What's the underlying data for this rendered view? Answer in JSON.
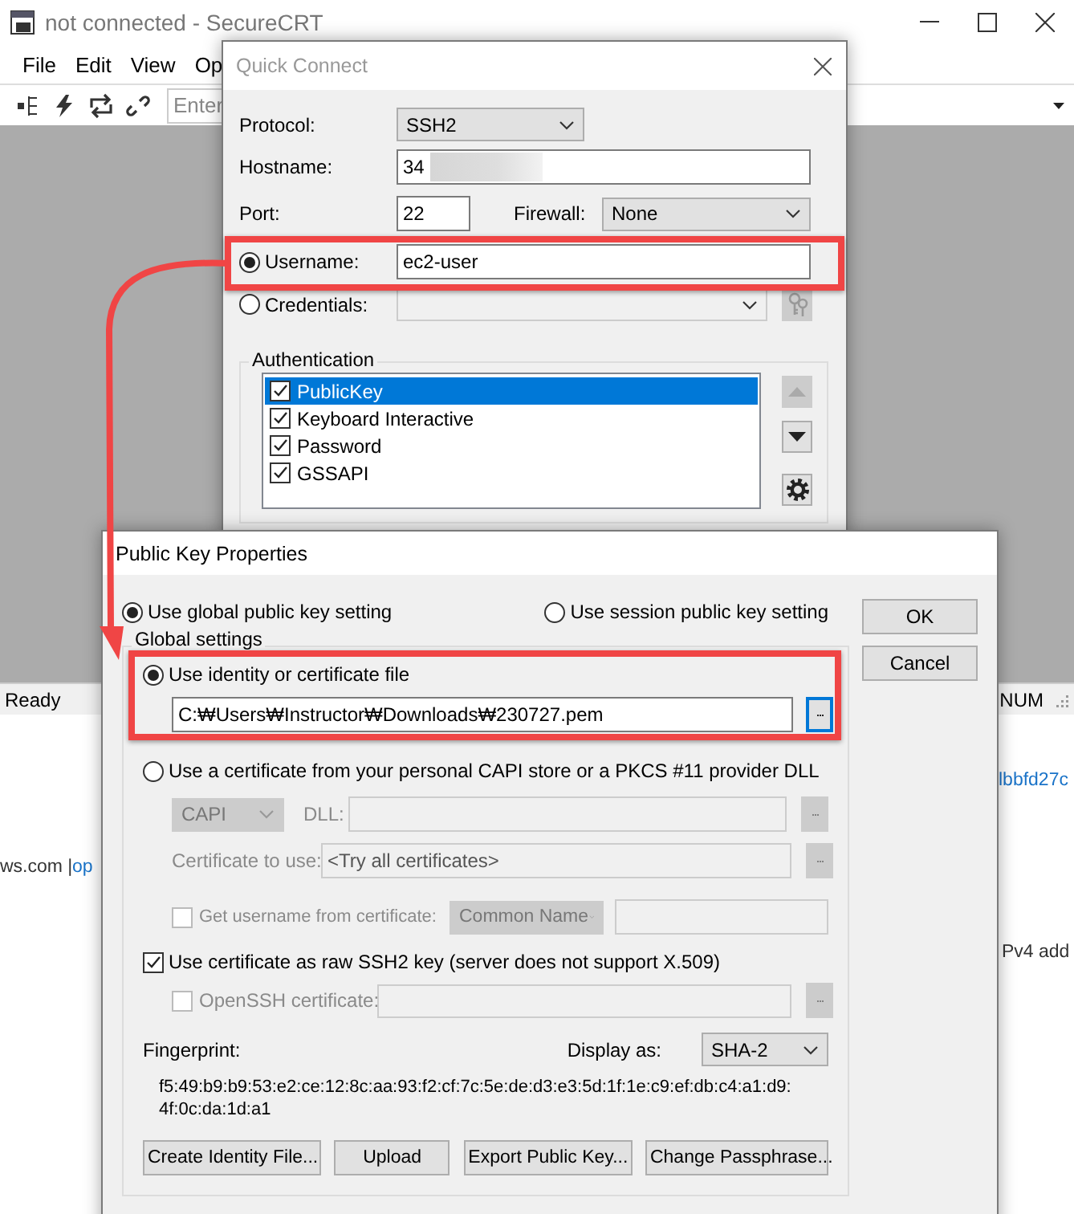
{
  "main_window": {
    "title": "not connected - SecureCRT",
    "menu": [
      "File",
      "Edit",
      "View",
      "Op"
    ],
    "toolbar_field": {
      "placeholder": "Enter"
    },
    "status_bar": {
      "left": "Ready",
      "indicator": "NUM"
    }
  },
  "background_page": {
    "fragments": [
      {
        "text": "lbbfd27c",
        "kind": "link"
      },
      {
        "text": "ws.com |",
        "kind": "plain"
      },
      {
        "text": "op",
        "kind": "link"
      },
      {
        "text": "Pv4 add",
        "kind": "plain"
      }
    ]
  },
  "quick_connect": {
    "title": "Quick Connect",
    "protocol": {
      "label": "Protocol:",
      "value": "SSH2"
    },
    "hostname": {
      "label": "Hostname:",
      "value": "34",
      "redacted": true
    },
    "port": {
      "label": "Port:",
      "value": "22"
    },
    "firewall": {
      "label": "Firewall:",
      "value": "None"
    },
    "username": {
      "label": "Username:",
      "value": "ec2-user",
      "selected": true
    },
    "credentials": {
      "label": "Credentials:",
      "selected": false,
      "disabled": true
    },
    "authentication": {
      "title": "Authentication",
      "items": [
        {
          "label": "PublicKey",
          "checked": true,
          "selected": true
        },
        {
          "label": "Keyboard Interactive",
          "checked": true,
          "selected": false
        },
        {
          "label": "Password",
          "checked": true,
          "selected": false
        },
        {
          "label": "GSSAPI",
          "checked": true,
          "selected": false
        }
      ],
      "order_buttons": [
        {
          "kind": "up",
          "disabled": true
        },
        {
          "kind": "down",
          "disabled": false
        }
      ]
    }
  },
  "public_key": {
    "title": "Public Key Properties",
    "scope": [
      {
        "label": "Use global public key setting",
        "selected": true
      },
      {
        "label": "Use session public key setting",
        "selected": false
      }
    ],
    "buttons": [
      "OK",
      "Cancel"
    ],
    "global_settings": {
      "title": "Global settings",
      "identity": {
        "label": "Use identity or certificate file",
        "selected": true,
        "path": "C:₩Users₩Instructor₩Downloads₩230727.pem"
      },
      "capi": {
        "label": "Use a certificate from your personal CAPI store or a PKCS #11 provider DLL",
        "selected": false,
        "type": "CAPI",
        "dll_label": "DLL:",
        "cert_label": "Certificate to use:",
        "cert_value": "<Try all certificates>",
        "disabled": true
      },
      "username_from_cert": {
        "label": "Get username from certificate:",
        "checked": false,
        "value": "Common Name",
        "disabled": true
      },
      "raw_ssh2": {
        "label": "Use certificate as raw SSH2 key (server does not support X.509)",
        "checked": true
      },
      "openssh": {
        "label": "OpenSSH certificate:",
        "checked": false,
        "disabled": true
      },
      "fingerprint": {
        "label": "Fingerprint:",
        "display_label": "Display as:",
        "display_value": "SHA-2",
        "lines": [
          "f5:49:b9:b9:53:e2:ce:12:8c:aa:93:f2:cf:7c:5e:de:d3:e3:5d:1f:1e:c9:ef:db:c4:a1:d9:",
          "4f:0c:da:1d:a1"
        ]
      },
      "browse_buttons": [
        "...",
        "...",
        "...",
        "..."
      ],
      "actions": [
        "Create Identity File...",
        "Upload",
        "Export Public Key...",
        "Change Passphrase..."
      ]
    }
  }
}
